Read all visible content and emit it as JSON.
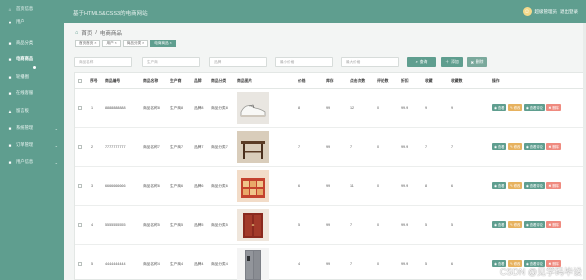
{
  "header": {
    "title": "基于HTML5&CSS3的电商网站",
    "user_label": "超级管理员",
    "logout_label": "退出登录"
  },
  "sidebar": {
    "items": [
      {
        "label": "首页信息",
        "icon": "home-icon"
      },
      {
        "label": "用户",
        "icon": "user-icon"
      },
      {
        "label": "商品分类",
        "icon": "tag-icon"
      },
      {
        "label": "电商商品",
        "icon": "shop-icon"
      },
      {
        "label": "轮播图",
        "icon": "image-icon"
      },
      {
        "label": "在线客服",
        "icon": "chat-icon"
      },
      {
        "label": "留言板",
        "icon": "message-icon"
      },
      {
        "label": "系统管理",
        "icon": "gear-icon"
      },
      {
        "label": "订单管理",
        "icon": "order-icon"
      },
      {
        "label": "用户信息",
        "icon": "profile-icon"
      }
    ],
    "active_index": 3
  },
  "breadcrumb": {
    "home": "首页",
    "separator": "/",
    "current": "电商商品"
  },
  "tabs": [
    "首页首页 ×",
    "用户 ×",
    "商品分类 ×",
    "电商商品 ×"
  ],
  "active_tab": 3,
  "search": {
    "fields": [
      {
        "placeholder": "商品名称"
      },
      {
        "placeholder": "生产商"
      },
      {
        "placeholder": "品牌"
      },
      {
        "placeholder": "最小价格"
      },
      {
        "placeholder": "最大价格"
      }
    ],
    "search_label": "查询",
    "add_label": "添加",
    "delete_label": "删除"
  },
  "table": {
    "headers": [
      "序号",
      "商品编号",
      "商品名称",
      "生产商",
      "品牌",
      "商品分类",
      "商品图片",
      "价格",
      "库存",
      "点击次数",
      "评论数",
      "折扣",
      "收藏",
      "收藏数",
      "操作"
    ],
    "rows": [
      {
        "no": "1",
        "code": "8888888888",
        "name": "商品名称8",
        "maker": "生产商8",
        "brand": "品牌8",
        "category": "商品分类8",
        "price": "8",
        "stock": "99",
        "clicks": "12",
        "comments": "0",
        "discount": "99.9",
        "fav": "9",
        "favcount": "9",
        "img": "shoe"
      },
      {
        "no": "2",
        "code": "7777777777",
        "name": "商品名称7",
        "maker": "生产商7",
        "brand": "品牌7",
        "category": "商品分类7",
        "price": "7",
        "stock": "99",
        "clicks": "7",
        "comments": "0",
        "discount": "99.9",
        "fav": "7",
        "favcount": "7",
        "img": "table"
      },
      {
        "no": "3",
        "code": "6666666666",
        "name": "商品名称6",
        "maker": "生产商6",
        "brand": "品牌6",
        "category": "商品分类6",
        "price": "6",
        "stock": "99",
        "clicks": "11",
        "comments": "0",
        "discount": "99.9",
        "fav": "8",
        "favcount": "6",
        "img": "gift"
      },
      {
        "no": "4",
        "code": "5555555555",
        "name": "商品名称5",
        "maker": "生产商5",
        "brand": "品牌5",
        "category": "商品分类5",
        "price": "5",
        "stock": "99",
        "clicks": "7",
        "comments": "0",
        "discount": "99.9",
        "fav": "5",
        "favcount": "5",
        "img": "cabinet"
      },
      {
        "no": "5",
        "code": "4444444444",
        "name": "商品名称4",
        "maker": "生产商4",
        "brand": "品牌4",
        "category": "商品分类4",
        "price": "4",
        "stock": "99",
        "clicks": "7",
        "comments": "0",
        "discount": "99.9",
        "fav": "5",
        "favcount": "6",
        "img": "fridge"
      }
    ],
    "actions": {
      "view": "查看",
      "edit": "修改",
      "review": "查看评论",
      "delete": "删除"
    }
  },
  "watermark": "CSDN @见学码毕设",
  "colors": {
    "primary": "#5f9e8f",
    "edit": "#e7b25f",
    "delete": "#ef8a7f"
  }
}
